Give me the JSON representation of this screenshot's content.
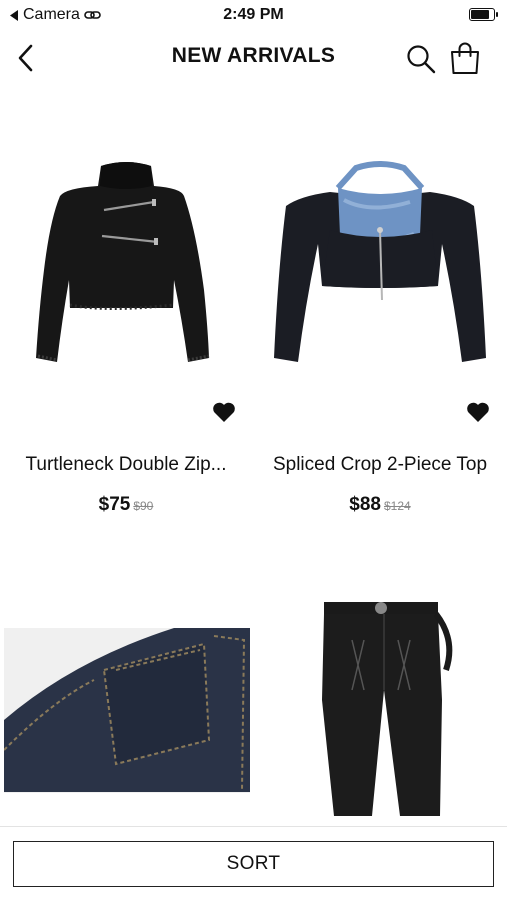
{
  "status_bar": {
    "back_app": "Camera",
    "time": "2:49 PM",
    "battery_level": 0.9
  },
  "header": {
    "title": "NEW ARRIVALS",
    "back_icon": "chevron-left-icon",
    "search_icon": "search-icon",
    "bag_icon": "shopping-bag-icon"
  },
  "products": [
    {
      "name": "Turtleneck Double Zip...",
      "price": "$75",
      "old_price": "$90",
      "image": "black-turtleneck-sweater",
      "favorite_icon": "heart-icon"
    },
    {
      "name": "Spliced Crop 2-Piece Top",
      "price": "$88",
      "old_price": "$124",
      "image": "black-crop-top-with-blue-denim-halter",
      "favorite_icon": "heart-icon"
    },
    {
      "name": "",
      "price": "",
      "old_price": "",
      "image": "dark-denim-pocket-closeup"
    },
    {
      "name": "",
      "price": "",
      "old_price": "",
      "image": "black-lace-up-jeans"
    }
  ],
  "footer": {
    "sort_label": "SORT"
  }
}
